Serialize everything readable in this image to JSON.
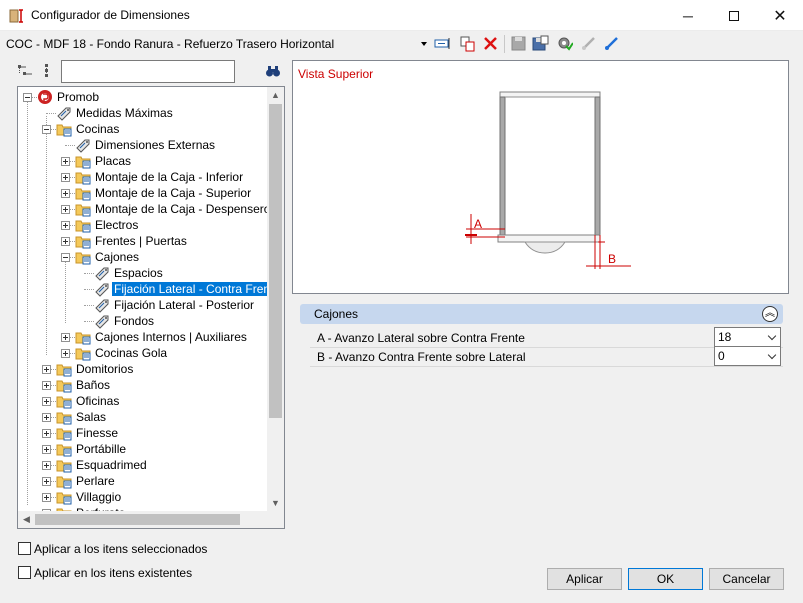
{
  "window": {
    "title": "Configurador de Dimensiones"
  },
  "toolbar": {
    "config_name": "COC - MDF 18 - Fondo Ranura - Refuerzo Trasero Horizontal"
  },
  "tree": {
    "search_value": "",
    "nodes": [
      {
        "label": "Promob"
      },
      {
        "label": "Medidas Máximas"
      },
      {
        "label": "Cocinas"
      },
      {
        "label": "Dimensiones Externas"
      },
      {
        "label": "Placas"
      },
      {
        "label": "Montaje de la Caja - Inferior"
      },
      {
        "label": "Montaje de la Caja - Superior"
      },
      {
        "label": "Montaje de la Caja - Despensero | T"
      },
      {
        "label": "Electros"
      },
      {
        "label": "Frentes | Puertas"
      },
      {
        "label": "Cajones"
      },
      {
        "label": "Espacios"
      },
      {
        "label": "Fijación Lateral - Contra Frente"
      },
      {
        "label": "Fijación Lateral - Posterior"
      },
      {
        "label": "Fondos"
      },
      {
        "label": "Cajones Internos | Auxiliares"
      },
      {
        "label": "Cocinas Gola"
      },
      {
        "label": "Domitorios"
      },
      {
        "label": "Baños"
      },
      {
        "label": "Oficinas"
      },
      {
        "label": "Salas"
      },
      {
        "label": "Finesse"
      },
      {
        "label": "Portábille"
      },
      {
        "label": "Esquadrimed"
      },
      {
        "label": "Perlare"
      },
      {
        "label": "Villaggio"
      },
      {
        "label": "Perfurato"
      }
    ]
  },
  "preview": {
    "title": "Vista Superior",
    "label_a": "A",
    "label_b": "B",
    "accent_color": "#cc0000"
  },
  "properties": {
    "group_label": "Cajones",
    "rows": [
      {
        "label": "A - Avanzo Lateral sobre Contra Frente",
        "value": "18"
      },
      {
        "label": "B - Avanzo Contra Frente sobre Lateral",
        "value": "0"
      }
    ]
  },
  "options": {
    "apply_selected": "Aplicar a los itens seleccionados",
    "apply_existing": "Aplicar en los itens existentes"
  },
  "buttons": {
    "apply": "Aplicar",
    "ok": "OK",
    "cancel": "Cancelar"
  }
}
